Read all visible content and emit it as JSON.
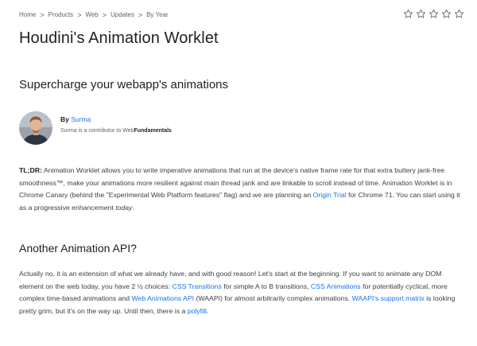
{
  "breadcrumb": {
    "items": [
      "Home",
      "Products",
      "Web",
      "Updates",
      "By Year"
    ],
    "separator": ">"
  },
  "rating": {
    "stars": 5,
    "filled": 0
  },
  "page_title": "Houdini's Animation Worklet",
  "subtitle": "Supercharge your webapp's animations",
  "author": {
    "by_prefix": "By",
    "name": "Surma",
    "desc_prefix": "Surma is a contributor to Web",
    "desc_bold": "Fundamentals"
  },
  "intro": {
    "lead": "TL;DR:",
    "text1": " Animation Worklet allows you to write imperative animations that run at the device's native frame rate for that extra buttery jank-free smoothness™, make your animations more resilient against main thread jank and are linkable to scroll instead of time. Animation Worklet is in Chrome Canary (behind the \"Experimental Web Platform features\" flag) and we are planning an ",
    "link_origin_trial": "Origin Trial",
    "text2": " for Chrome 71. You can start using it as a progressive enhancement ",
    "emphasis": "today",
    "text3": "."
  },
  "section_heading": "Another Animation API?",
  "body": {
    "text1": "Actually no, it is an extension of what we already have, and with good reason! Let's start at the beginning. If you want to animate any DOM element on the web today, you have 2 ½ choices: ",
    "link_css_transitions": "CSS Transitions",
    "text2": " for simple A to B transitions, ",
    "link_css_animations": "CSS Animations",
    "text3": " for potentially cyclical, more complex time-based animations and ",
    "link_waapi": "Web Animations API",
    "text4": " (WAAPI) for almost arbitrarily complex animations. ",
    "link_support_matrix": "WAAPI's support matrix",
    "text5": " is looking pretty grim, but it's on the way up. Until then, there is a ",
    "link_polyfill": "polyfill",
    "text6": "."
  },
  "colors": {
    "link": "#1a73e8",
    "text": "#3c4043",
    "heading": "#202124",
    "muted": "#5f6368"
  }
}
